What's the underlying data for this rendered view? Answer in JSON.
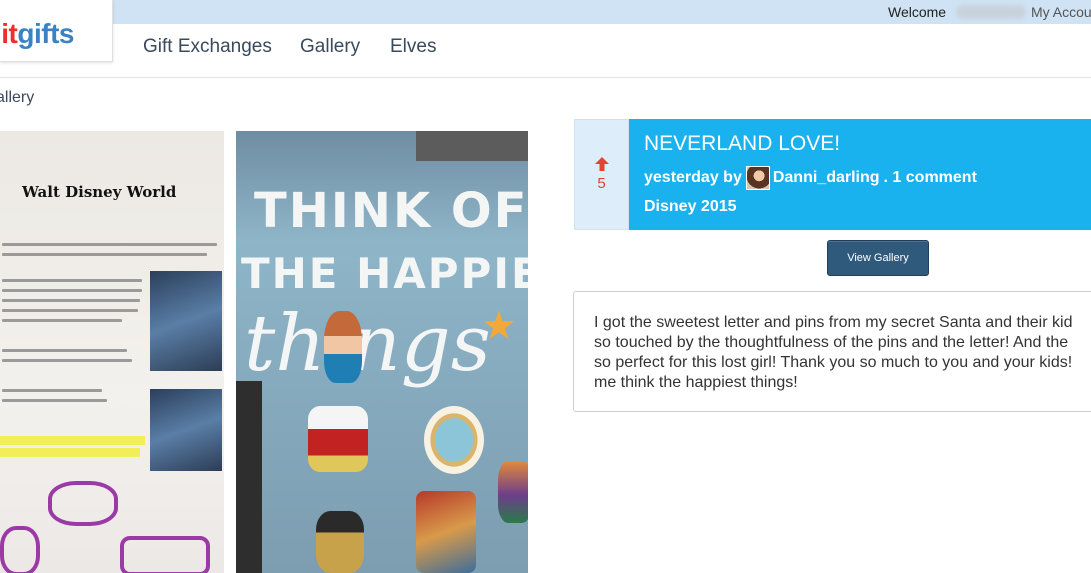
{
  "header": {
    "logo_left": "lit",
    "logo_right": "gifts",
    "welcome": "Welcome",
    "account": "My Accou"
  },
  "nav": {
    "items": [
      {
        "label": "Gift Exchanges"
      },
      {
        "label": "Gallery"
      },
      {
        "label": "Elves"
      }
    ]
  },
  "breadcrumb": {
    "current": "allery"
  },
  "photos": {
    "letter_heading": "Walt Disney World",
    "shirt_line1": "THINK OF",
    "shirt_line2": "THE HAPPIEST",
    "shirt_line3": "things"
  },
  "post": {
    "vote_count": "5",
    "title": "NEVERLAND LOVE!",
    "time": "yesterday by",
    "author": "Danni_darling",
    "comments": ". 1 comment",
    "tag": "Disney 2015",
    "view_gallery": "View Gallery",
    "description": "I got the sweetest letter and pins from my secret Santa and their kid\nso touched by the thoughtfulness of the pins and the letter! And the\nso perfect for this lost girl! Thank you so much to you and your kids!\nme think the happiest things!"
  },
  "colors": {
    "accent": "#1ab2ee",
    "topbar": "#cfe3f4",
    "button": "#2f5a7c",
    "vote": "#e04433"
  }
}
